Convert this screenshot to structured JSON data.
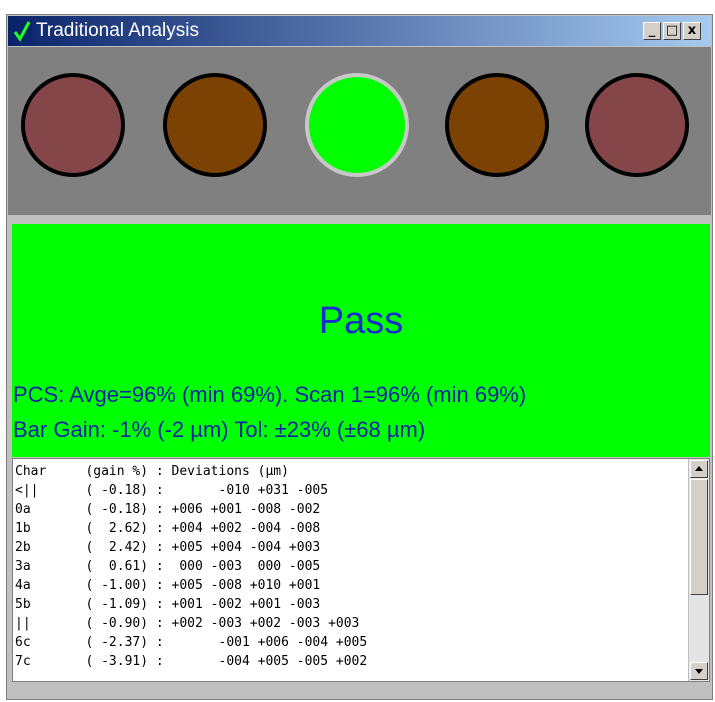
{
  "window": {
    "title": "Traditional Analysis",
    "icon": "checkmark-app-icon",
    "buttons": {
      "minimize": "_",
      "maximize": "□",
      "close": "x"
    }
  },
  "indicators": [
    {
      "name": "lamp-1",
      "color": "#85464a",
      "active": false
    },
    {
      "name": "lamp-2",
      "color": "#7b4204",
      "active": false
    },
    {
      "name": "lamp-3",
      "color": "#00ff00",
      "active": true
    },
    {
      "name": "lamp-4",
      "color": "#7b4204",
      "active": false
    },
    {
      "name": "lamp-5",
      "color": "#85464a",
      "active": false
    }
  ],
  "status": {
    "result": "Pass",
    "pcs_line": "PCS: Avge=96% (min 69%). Scan 1=96% (min 69%)",
    "bar_gain_line": "Bar Gain: -1% (-2 µm) Tol: ±23% (±68 µm)",
    "background_color": "#00ff00"
  },
  "log": {
    "lines": [
      "Char     (gain %) : Deviations (µm)",
      "<||      ( -0.18) :       -010 +031 -005",
      "0a       ( -0.18) : +006 +001 -008 -002",
      "1b       (  2.62) : +004 +002 -004 -008",
      "2b       (  2.42) : +005 +004 -004 +003",
      "3a       (  0.61) :  000 -003  000 -005",
      "4a       ( -1.00) : +005 -008 +010 +001",
      "5b       ( -1.09) : +001 -002 +001 -003",
      "||       ( -0.90) : +002 -003 +002 -003 +003",
      "6c       ( -2.37) :       -001 +006 -004 +005",
      "7c       ( -3.91) :       -004 +005 -005 +002"
    ],
    "scroll_position": 0.0
  }
}
